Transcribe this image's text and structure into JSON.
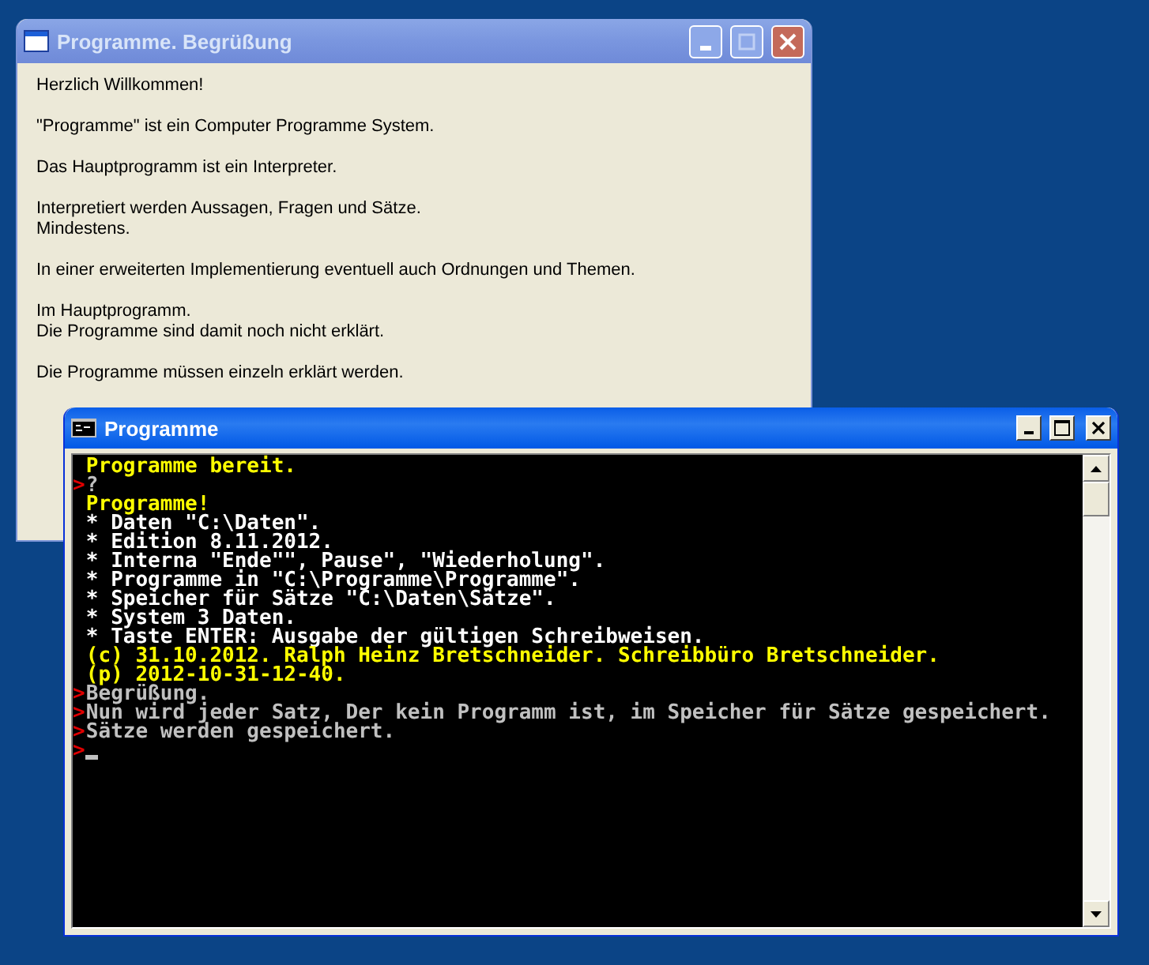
{
  "welcome_window": {
    "title": "Programme. Begrüßung",
    "active": false,
    "paragraphs": [
      [
        "Herzlich Willkommen!"
      ],
      [
        "\"Programme\" ist ein Computer Programme System."
      ],
      [
        "Das Hauptprogramm ist ein Interpreter."
      ],
      [
        "Interpretiert werden Aussagen, Fragen und Sätze.",
        "Mindestens."
      ],
      [
        "In einer erweiterten Implementierung eventuell auch Ordnungen und Themen."
      ],
      [
        "Im Hauptprogramm.",
        "Die Programme sind damit noch nicht erklärt."
      ],
      [
        "Die Programme müssen einzeln erklärt werden."
      ]
    ]
  },
  "console_window": {
    "title": "Programme",
    "active": true,
    "lines": [
      {
        "text": "Programme bereit.",
        "color": "#ffff00"
      },
      {
        "prompt": ">",
        "text": "?",
        "color": "#c0c0c0"
      },
      {
        "text": "Programme!",
        "color": "#ffff00"
      },
      {
        "text": "* Daten \"C:\\Daten\".",
        "color": "#ffffff"
      },
      {
        "text": "* Edition 8.11.2012.",
        "color": "#ffffff"
      },
      {
        "text": "* Interna \"Ende\"\", Pause\", \"Wiederholung\".",
        "color": "#ffffff"
      },
      {
        "text": "* Programme in \"C:\\Programme\\Programme\".",
        "color": "#ffffff"
      },
      {
        "text": "* Speicher für Sätze \"C:\\Daten\\Sätze\".",
        "color": "#ffffff"
      },
      {
        "text": "* System 3 Daten.",
        "color": "#ffffff"
      },
      {
        "text": "* Taste ENTER: Ausgabe der gültigen Schreibweisen.",
        "color": "#ffffff"
      },
      {
        "text": "(c) 31.10.2012. Ralph Heinz Bretschneider. Schreibbüro Bretschneider.",
        "color": "#ffff00"
      },
      {
        "text": "(p) 2012-10-31-12-40.",
        "color": "#ffff00"
      },
      {
        "prompt": ">",
        "text": "Begrüßung.",
        "color": "#c0c0c0"
      },
      {
        "prompt": ">",
        "text": "Nun wird jeder Satz, Der kein Programm ist, im Speicher für Sätze gespeichert.",
        "color": "#c0c0c0"
      },
      {
        "prompt": ">",
        "text": "Sätze werden gespeichert.",
        "color": "#c0c0c0"
      },
      {
        "prompt": ">",
        "cursor": true,
        "color": "#c0c0c0"
      }
    ]
  }
}
